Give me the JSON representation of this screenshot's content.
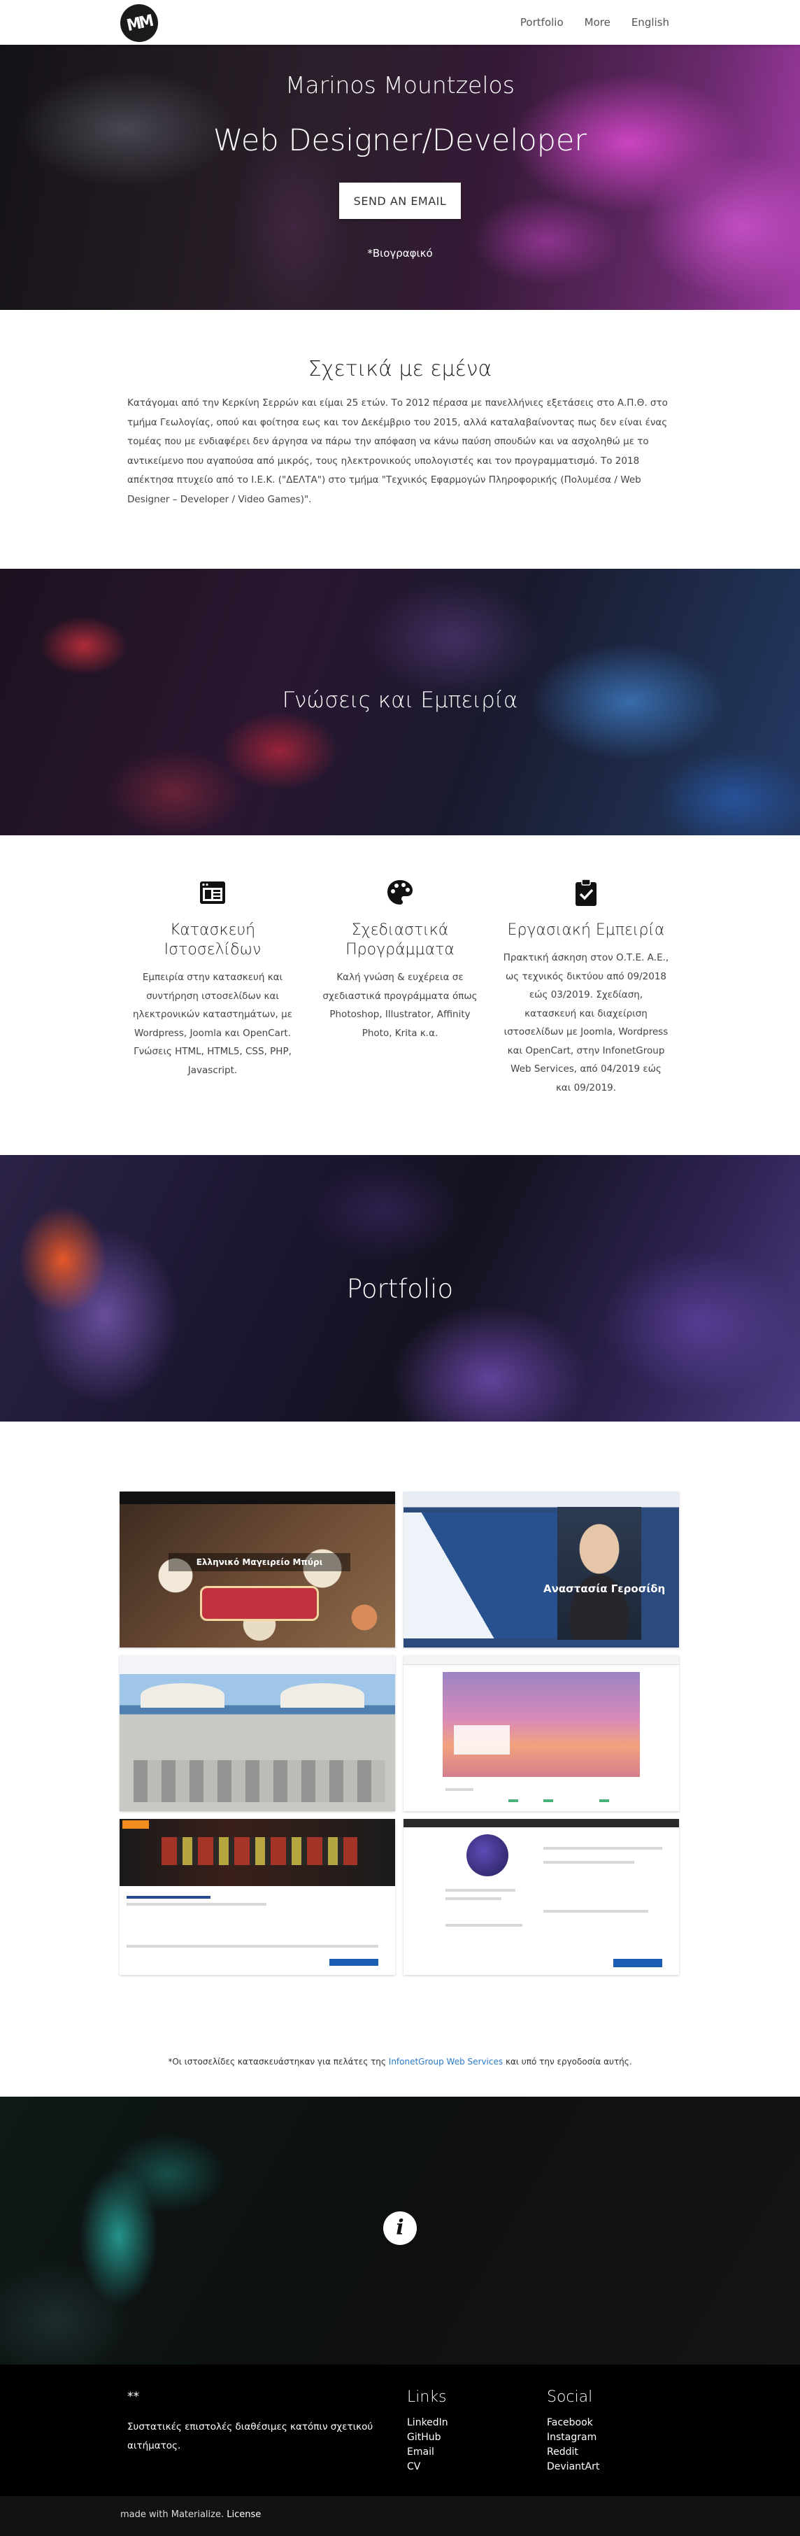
{
  "nav": {
    "logo_text": "MM",
    "links": [
      "Portfolio",
      "More",
      "English"
    ]
  },
  "hero": {
    "name": "Marinos Mountzelos",
    "role": "Web Designer/Developer",
    "button": "SEND AN EMAIL",
    "bio_link": "*Βιογραφικό"
  },
  "about": {
    "title": "Σχετικά με εμένα",
    "text": "Κατάγομαι από την Κερκίνη Σερρών και είμαι 25 ετών. Το 2012 πέρασα με πανελλήνιες εξετάσεις στο Α.Π.Θ. στο τμήμα Γεωλογίας, οπού και φοίτησα εως και τον Δεκέμβριο του 2015, αλλά καταλαβαίνοντας πως δεν είναι ένας τομέας που με ενδιαφέρει δεν άργησα να πάρω την απόφαση να κάνω παύση σπουδών και να ασχοληθώ με το αντικείμενο που αγαπούσα από μικρός, τους ηλεκτρονικούς υπολογιστές και τον προγραμματισμό. Το 2018 απέκτησα πτυχείο από το Ι.Ε.Κ. (\"ΔΕΛΤΑ\") στο τμήμα \"Τεχνικός Εφαρμογών Πληροφορικής (Πολυμέσα / Web Designer – Developer / Video Games)\"."
  },
  "knowledge": {
    "title": "Γνώσεις και Εμπειρία"
  },
  "skills": [
    {
      "icon": "web-icon",
      "title": "Κατασκευή Ιστοσελίδων",
      "text": "Εμπειρία στην κατασκευή και συντήρηση ιστοσελίδων και ηλεκτρονικών καταστημάτων, με Wordpress, Joomla και OpenCart. Γνώσεις HTML, HTML5, CSS, PHP, Javascript."
    },
    {
      "icon": "palette-icon",
      "title": "Σχεδιαστικά Προγράμματα",
      "text": "Καλή γνώση & ευχέρεια σε σχεδιαστικά προγράμματα όπως Photoshop, Illustrator, Affinity Photo, Krita κ.α."
    },
    {
      "icon": "clipboard-check-icon",
      "title": "Εργασιακή Εμπειρία",
      "text": "Πρακτική άσκηση στον Ο.Τ.Ε. Α.Ε., ως τεχνικός δικτύου από 09/2018 εώς 03/2019. Σχεδίαση, κατασκευή και διαχείριση ιστοσελίδων με Joomla, Wordpress και OpenCart, στην InfonetGroup Web Services, από 04/2019 εώς και 09/2019."
    }
  ],
  "portfolio": {
    "title": "Portfolio",
    "thumb_texts": {
      "t1_banner": "Ελληνικό Μαγειρείο Μπύρι",
      "t2_title": "Αναστασία Γεροσίδη"
    },
    "note_prefix": "*Οι ιστοσελίδες κατασκευάστηκαν για πελάτες της ",
    "note_link": "InfonetGroup Web Services",
    "note_suffix": " και υπό την εργοδοσία αυτής."
  },
  "footer": {
    "title": "**",
    "text": "Συστατικές επιστολές διαθέσιμες κατόπιν σχετικού αιτήματος.",
    "links_title": "Links",
    "links": [
      "LinkedIn",
      "GitHub",
      "Email",
      "CV"
    ],
    "social_title": "Social",
    "social": [
      "Facebook",
      "Instagram",
      "Reddit",
      "DeviantArt"
    ],
    "made_prefix": "made with Materialize.",
    "license": "License"
  }
}
